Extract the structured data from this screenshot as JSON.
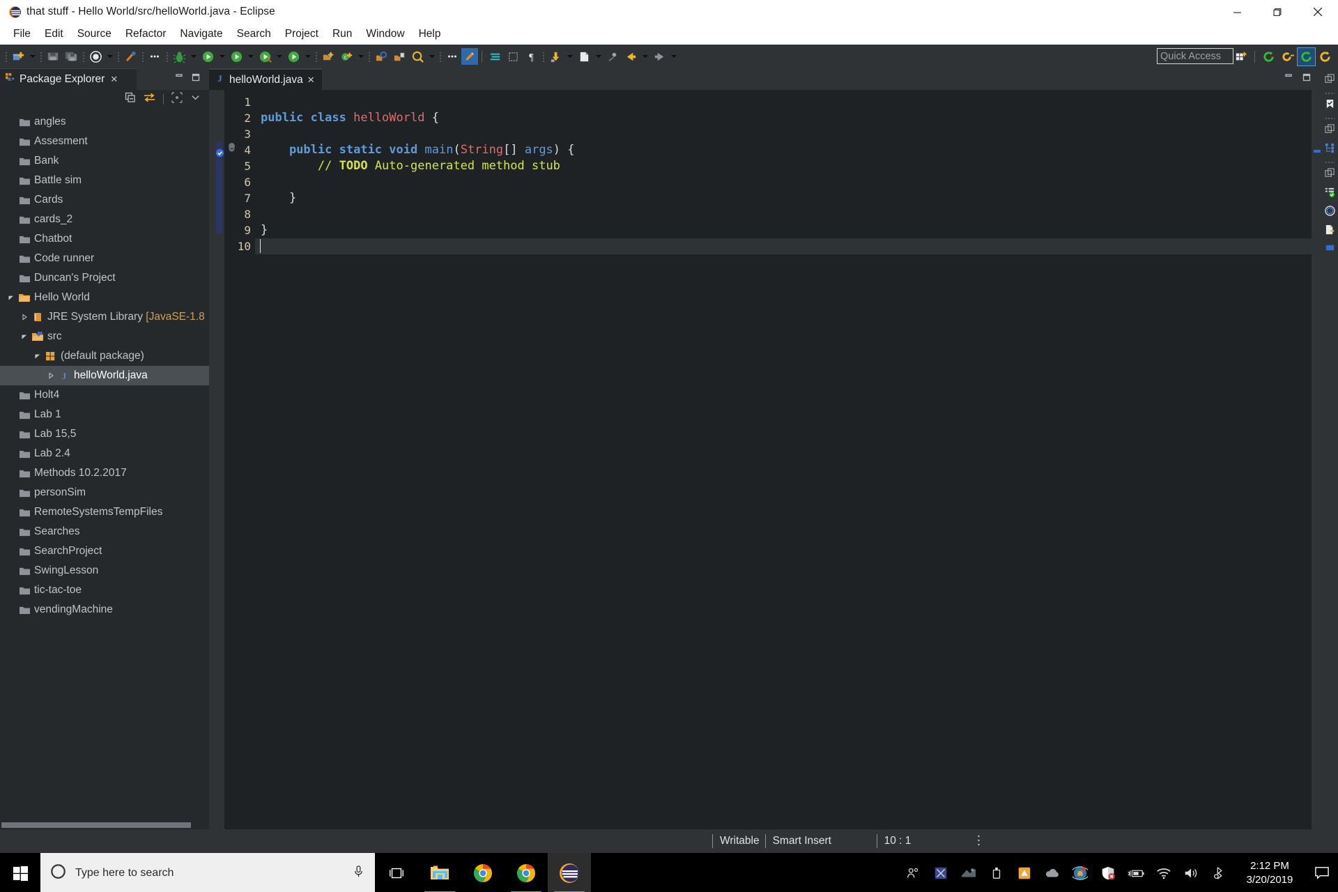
{
  "window": {
    "title": "that stuff - Hello World/src/helloWorld.java - Eclipse",
    "app_icon": "eclipse-icon",
    "minimize_label": "Minimize",
    "maximize_label": "Restore",
    "close_label": "Close"
  },
  "menubar": {
    "items": [
      {
        "label": "File"
      },
      {
        "label": "Edit"
      },
      {
        "label": "Source"
      },
      {
        "label": "Refactor"
      },
      {
        "label": "Navigate"
      },
      {
        "label": "Search"
      },
      {
        "label": "Project"
      },
      {
        "label": "Run"
      },
      {
        "label": "Window"
      },
      {
        "label": "Help"
      }
    ]
  },
  "toolbar": {
    "quick_access_placeholder": "Quick Access",
    "buttons": [
      {
        "name": "new-wizard",
        "icon": "new-file-icon"
      },
      {
        "name": "save",
        "icon": "save-icon"
      },
      {
        "name": "save-all",
        "icon": "save-all-icon"
      },
      {
        "name": "toggle-mark-occurrences",
        "icon": "mark-occurrences-icon"
      },
      {
        "name": "new-java-package",
        "icon": "link-icon"
      },
      {
        "name": "debug-last",
        "icon": "bug-icon"
      },
      {
        "name": "run",
        "icon": "run-icon"
      },
      {
        "name": "run-external-tools",
        "icon": "external-tools-icon"
      },
      {
        "name": "coverage",
        "icon": "coverage-icon"
      },
      {
        "name": "new-java-project",
        "icon": "new-project-icon"
      },
      {
        "name": "new-class",
        "icon": "new-class-icon"
      },
      {
        "name": "open-type",
        "icon": "open-type-icon"
      },
      {
        "name": "open-task",
        "icon": "open-task-icon"
      },
      {
        "name": "search",
        "icon": "search-icon"
      },
      {
        "name": "last-edit-location",
        "icon": "pencil-icon"
      },
      {
        "name": "toggle-breadcrumb",
        "icon": "breadcrumb-icon"
      },
      {
        "name": "block-selection",
        "icon": "block-selection-icon"
      },
      {
        "name": "show-whitespace",
        "icon": "pilcrow-icon"
      },
      {
        "name": "restore-from-local-history",
        "icon": "history-icon"
      },
      {
        "name": "new-annotation",
        "icon": "annotation-icon"
      },
      {
        "name": "previous-annotation",
        "icon": "prev-annotation-icon"
      },
      {
        "name": "back",
        "icon": "back-arrow-icon"
      },
      {
        "name": "forward",
        "icon": "forward-arrow-icon"
      }
    ],
    "perspectives": [
      {
        "name": "open-perspective",
        "icon": "open-perspective-icon",
        "active": false
      },
      {
        "name": "perspective-java",
        "icon": "java-perspective-icon",
        "active": false
      },
      {
        "name": "perspective-cpp",
        "icon": "cpp-perspective-icon",
        "active": false
      },
      {
        "name": "perspective-java-active",
        "icon": "java-perspective-icon",
        "active": true
      },
      {
        "name": "perspective-java-browsing",
        "icon": "java-browsing-icon",
        "active": false
      }
    ]
  },
  "package_explorer": {
    "title": "Package Explorer",
    "close_label": "✕",
    "view_menu_icons": [
      {
        "name": "collapse-all-icon"
      },
      {
        "name": "link-with-editor-icon"
      },
      {
        "name": "focus-on-active-task-icon"
      },
      {
        "name": "view-menu-icon"
      }
    ],
    "window_icons": [
      {
        "name": "minimize-view-icon"
      },
      {
        "name": "maximize-view-icon"
      }
    ],
    "tree": [
      {
        "label": "angles",
        "icon": "folder-icon",
        "indent": 0,
        "twisty": "none",
        "selected": false
      },
      {
        "label": "Assesment",
        "icon": "folder-icon",
        "indent": 0,
        "twisty": "none",
        "selected": false
      },
      {
        "label": "Bank",
        "icon": "folder-icon",
        "indent": 0,
        "twisty": "none",
        "selected": false
      },
      {
        "label": "Battle sim",
        "icon": "folder-icon",
        "indent": 0,
        "twisty": "none",
        "selected": false
      },
      {
        "label": "Cards",
        "icon": "folder-icon",
        "indent": 0,
        "twisty": "none",
        "selected": false
      },
      {
        "label": "cards_2",
        "icon": "folder-icon",
        "indent": 0,
        "twisty": "none",
        "selected": false
      },
      {
        "label": "Chatbot",
        "icon": "folder-icon",
        "indent": 0,
        "twisty": "none",
        "selected": false
      },
      {
        "label": "Code runner",
        "icon": "folder-icon",
        "indent": 0,
        "twisty": "none",
        "selected": false
      },
      {
        "label": "Duncan's Project",
        "icon": "folder-icon",
        "indent": 0,
        "twisty": "none",
        "selected": false
      },
      {
        "label": "Hello World",
        "icon": "java-project-icon",
        "indent": 0,
        "twisty": "expanded",
        "selected": false
      },
      {
        "label": "JRE System Library ",
        "suffix": "[JavaSE-1.8",
        "icon": "jre-library-icon",
        "indent": 1,
        "twisty": "collapsed",
        "selected": false
      },
      {
        "label": "src",
        "icon": "source-folder-icon",
        "indent": 1,
        "twisty": "expanded",
        "selected": false
      },
      {
        "label": "(default package)",
        "icon": "package-icon",
        "indent": 2,
        "twisty": "expanded",
        "selected": false
      },
      {
        "label": "helloWorld.java",
        "icon": "java-file-icon",
        "indent": 3,
        "twisty": "collapsed",
        "selected": true
      },
      {
        "label": "Holt4",
        "icon": "folder-icon",
        "indent": 0,
        "twisty": "none",
        "selected": false
      },
      {
        "label": "Lab 1",
        "icon": "folder-icon",
        "indent": 0,
        "twisty": "none",
        "selected": false
      },
      {
        "label": "Lab 15,5",
        "icon": "folder-icon",
        "indent": 0,
        "twisty": "none",
        "selected": false
      },
      {
        "label": "Lab 2.4",
        "icon": "folder-icon",
        "indent": 0,
        "twisty": "none",
        "selected": false
      },
      {
        "label": "Methods 10.2.2017",
        "icon": "folder-icon",
        "indent": 0,
        "twisty": "none",
        "selected": false
      },
      {
        "label": "personSim",
        "icon": "folder-icon",
        "indent": 0,
        "twisty": "none",
        "selected": false
      },
      {
        "label": "RemoteSystemsTempFiles",
        "icon": "folder-icon",
        "indent": 0,
        "twisty": "none",
        "selected": false
      },
      {
        "label": "Searches",
        "icon": "folder-icon",
        "indent": 0,
        "twisty": "none",
        "selected": false
      },
      {
        "label": "SearchProject",
        "icon": "folder-icon",
        "indent": 0,
        "twisty": "none",
        "selected": false
      },
      {
        "label": "SwingLesson",
        "icon": "folder-icon",
        "indent": 0,
        "twisty": "none",
        "selected": false
      },
      {
        "label": "tic-tac-toe",
        "icon": "folder-icon",
        "indent": 0,
        "twisty": "none",
        "selected": false
      },
      {
        "label": "vendingMachine",
        "icon": "folder-icon",
        "indent": 0,
        "twisty": "none",
        "selected": false
      }
    ]
  },
  "editor": {
    "tab": {
      "label": "helloWorld.java",
      "icon": "java-file-icon",
      "close_label": "✕",
      "dirty": false
    },
    "window_icons": [
      {
        "name": "minimize-editor-icon"
      },
      {
        "name": "maximize-editor-icon"
      }
    ],
    "line_numbers": [
      "1",
      "2",
      "3",
      "4",
      "5",
      "6",
      "7",
      "8",
      "9",
      "10"
    ],
    "current_line": 10,
    "lines": [
      {
        "n": 1,
        "text": ""
      },
      {
        "n": 2,
        "text": "public class helloWorld {"
      },
      {
        "n": 3,
        "text": ""
      },
      {
        "n": 4,
        "text": "    public static void main(String[] args) {"
      },
      {
        "n": 5,
        "text": "        // TODO Auto-generated method stub"
      },
      {
        "n": 6,
        "text": ""
      },
      {
        "n": 7,
        "text": "    }"
      },
      {
        "n": 8,
        "text": ""
      },
      {
        "n": 9,
        "text": "}"
      },
      {
        "n": 10,
        "text": ""
      }
    ],
    "markers": [
      {
        "line": 4,
        "name": "folding-marker",
        "icon": "collapse-method-icon"
      },
      {
        "line": 5,
        "name": "todo-task-marker",
        "icon": "task-marker-icon"
      }
    ],
    "right_icon_bar": [
      {
        "name": "restore-view-icon"
      },
      {
        "name": "task-list-icon"
      },
      {
        "name": "restore-view-icon-2"
      },
      {
        "name": "package-explorer-icon"
      },
      {
        "name": "restore-view-icon-3"
      },
      {
        "name": "problems-view-icon"
      },
      {
        "name": "javadoc-view-icon"
      },
      {
        "name": "declaration-view-icon"
      }
    ]
  },
  "statusbar": {
    "writable": "Writable",
    "insert_mode": "Smart Insert",
    "position": "10 : 1",
    "menu_icon": "kebab-menu-icon"
  },
  "taskbar": {
    "start_label": "Start",
    "search_placeholder": "Type here to search",
    "search_icon": "cortana-circle-icon",
    "mic_icon": "microphone-icon",
    "apps": [
      {
        "name": "task-view",
        "icon": "task-view-icon",
        "active": false,
        "running": false
      },
      {
        "name": "file-explorer",
        "icon": "file-explorer-icon",
        "active": false,
        "running": true
      },
      {
        "name": "chrome-1",
        "icon": "chrome-icon",
        "active": false,
        "running": false
      },
      {
        "name": "chrome-2",
        "icon": "chrome-icon",
        "active": false,
        "running": true
      },
      {
        "name": "eclipse",
        "icon": "eclipse-icon",
        "active": true,
        "running": true
      }
    ],
    "tray": [
      {
        "name": "people-icon"
      },
      {
        "name": "app-tray-icon-1"
      },
      {
        "name": "app-tray-icon-2"
      },
      {
        "name": "usb-icon"
      },
      {
        "name": "amber-app-icon"
      },
      {
        "name": "onedrive-icon"
      },
      {
        "name": "globe-app-icon"
      },
      {
        "name": "security-shield-icon"
      },
      {
        "name": "battery-icon"
      },
      {
        "name": "wifi-icon"
      },
      {
        "name": "volume-icon"
      },
      {
        "name": "bluetooth-headset-icon"
      }
    ],
    "clock_time": "2:12 PM",
    "clock_date": "3/20/2019",
    "notification_icon": "notification-icon"
  },
  "colors": {
    "editor_bg": "#1f2224",
    "chrome_bg": "#2f3336",
    "panel_bg": "#26292c",
    "selection": "#4a4f54",
    "keyword": "#5e9bd9",
    "type": "#e06c6c",
    "comment": "#d2e34b",
    "linenum": "#d3c6aa",
    "accent_orange": "#e8a33d"
  }
}
